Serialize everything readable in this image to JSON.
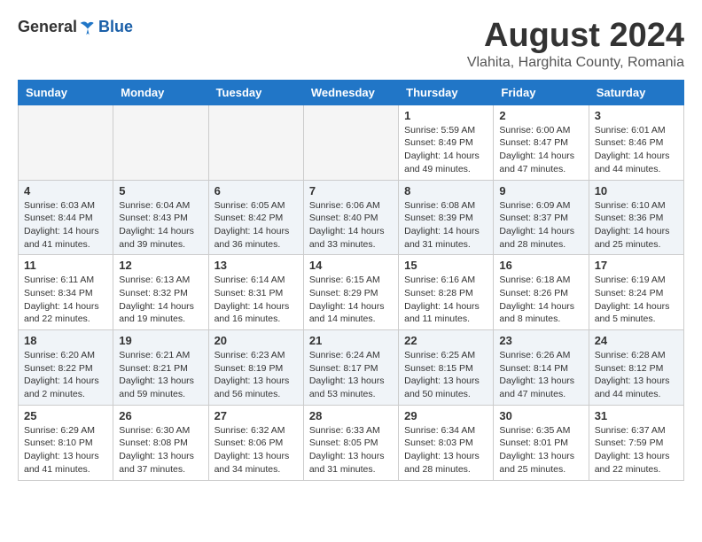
{
  "header": {
    "logo": {
      "general": "General",
      "blue": "Blue"
    },
    "title": "August 2024",
    "location": "Vlahita, Harghita County, Romania"
  },
  "weekdays": [
    "Sunday",
    "Monday",
    "Tuesday",
    "Wednesday",
    "Thursday",
    "Friday",
    "Saturday"
  ],
  "weeks": [
    [
      {
        "day": "",
        "info": ""
      },
      {
        "day": "",
        "info": ""
      },
      {
        "day": "",
        "info": ""
      },
      {
        "day": "",
        "info": ""
      },
      {
        "day": "1",
        "info": "Sunrise: 5:59 AM\nSunset: 8:49 PM\nDaylight: 14 hours\nand 49 minutes."
      },
      {
        "day": "2",
        "info": "Sunrise: 6:00 AM\nSunset: 8:47 PM\nDaylight: 14 hours\nand 47 minutes."
      },
      {
        "day": "3",
        "info": "Sunrise: 6:01 AM\nSunset: 8:46 PM\nDaylight: 14 hours\nand 44 minutes."
      }
    ],
    [
      {
        "day": "4",
        "info": "Sunrise: 6:03 AM\nSunset: 8:44 PM\nDaylight: 14 hours\nand 41 minutes."
      },
      {
        "day": "5",
        "info": "Sunrise: 6:04 AM\nSunset: 8:43 PM\nDaylight: 14 hours\nand 39 minutes."
      },
      {
        "day": "6",
        "info": "Sunrise: 6:05 AM\nSunset: 8:42 PM\nDaylight: 14 hours\nand 36 minutes."
      },
      {
        "day": "7",
        "info": "Sunrise: 6:06 AM\nSunset: 8:40 PM\nDaylight: 14 hours\nand 33 minutes."
      },
      {
        "day": "8",
        "info": "Sunrise: 6:08 AM\nSunset: 8:39 PM\nDaylight: 14 hours\nand 31 minutes."
      },
      {
        "day": "9",
        "info": "Sunrise: 6:09 AM\nSunset: 8:37 PM\nDaylight: 14 hours\nand 28 minutes."
      },
      {
        "day": "10",
        "info": "Sunrise: 6:10 AM\nSunset: 8:36 PM\nDaylight: 14 hours\nand 25 minutes."
      }
    ],
    [
      {
        "day": "11",
        "info": "Sunrise: 6:11 AM\nSunset: 8:34 PM\nDaylight: 14 hours\nand 22 minutes."
      },
      {
        "day": "12",
        "info": "Sunrise: 6:13 AM\nSunset: 8:32 PM\nDaylight: 14 hours\nand 19 minutes."
      },
      {
        "day": "13",
        "info": "Sunrise: 6:14 AM\nSunset: 8:31 PM\nDaylight: 14 hours\nand 16 minutes."
      },
      {
        "day": "14",
        "info": "Sunrise: 6:15 AM\nSunset: 8:29 PM\nDaylight: 14 hours\nand 14 minutes."
      },
      {
        "day": "15",
        "info": "Sunrise: 6:16 AM\nSunset: 8:28 PM\nDaylight: 14 hours\nand 11 minutes."
      },
      {
        "day": "16",
        "info": "Sunrise: 6:18 AM\nSunset: 8:26 PM\nDaylight: 14 hours\nand 8 minutes."
      },
      {
        "day": "17",
        "info": "Sunrise: 6:19 AM\nSunset: 8:24 PM\nDaylight: 14 hours\nand 5 minutes."
      }
    ],
    [
      {
        "day": "18",
        "info": "Sunrise: 6:20 AM\nSunset: 8:22 PM\nDaylight: 14 hours\nand 2 minutes."
      },
      {
        "day": "19",
        "info": "Sunrise: 6:21 AM\nSunset: 8:21 PM\nDaylight: 13 hours\nand 59 minutes."
      },
      {
        "day": "20",
        "info": "Sunrise: 6:23 AM\nSunset: 8:19 PM\nDaylight: 13 hours\nand 56 minutes."
      },
      {
        "day": "21",
        "info": "Sunrise: 6:24 AM\nSunset: 8:17 PM\nDaylight: 13 hours\nand 53 minutes."
      },
      {
        "day": "22",
        "info": "Sunrise: 6:25 AM\nSunset: 8:15 PM\nDaylight: 13 hours\nand 50 minutes."
      },
      {
        "day": "23",
        "info": "Sunrise: 6:26 AM\nSunset: 8:14 PM\nDaylight: 13 hours\nand 47 minutes."
      },
      {
        "day": "24",
        "info": "Sunrise: 6:28 AM\nSunset: 8:12 PM\nDaylight: 13 hours\nand 44 minutes."
      }
    ],
    [
      {
        "day": "25",
        "info": "Sunrise: 6:29 AM\nSunset: 8:10 PM\nDaylight: 13 hours\nand 41 minutes."
      },
      {
        "day": "26",
        "info": "Sunrise: 6:30 AM\nSunset: 8:08 PM\nDaylight: 13 hours\nand 37 minutes."
      },
      {
        "day": "27",
        "info": "Sunrise: 6:32 AM\nSunset: 8:06 PM\nDaylight: 13 hours\nand 34 minutes."
      },
      {
        "day": "28",
        "info": "Sunrise: 6:33 AM\nSunset: 8:05 PM\nDaylight: 13 hours\nand 31 minutes."
      },
      {
        "day": "29",
        "info": "Sunrise: 6:34 AM\nSunset: 8:03 PM\nDaylight: 13 hours\nand 28 minutes."
      },
      {
        "day": "30",
        "info": "Sunrise: 6:35 AM\nSunset: 8:01 PM\nDaylight: 13 hours\nand 25 minutes."
      },
      {
        "day": "31",
        "info": "Sunrise: 6:37 AM\nSunset: 7:59 PM\nDaylight: 13 hours\nand 22 minutes."
      }
    ]
  ]
}
